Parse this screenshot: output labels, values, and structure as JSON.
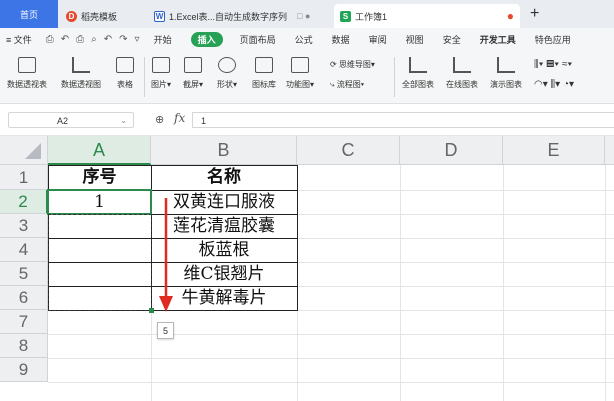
{
  "tabs": {
    "home": "首页",
    "template": "稻壳模板",
    "doc": "1.Excel表...自动生成数字序列",
    "doc_status": "□ ●",
    "workbook": "工作簿1",
    "workbook_dot": "●",
    "new_tab": "+"
  },
  "menu": {
    "file": "≡ 文件",
    "quick_access": [
      "⎙",
      "↶",
      "⎙",
      "⌕",
      "↶",
      "↷",
      "▿"
    ],
    "items": [
      "开始",
      "插入",
      "页面布局",
      "公式",
      "数据",
      "审阅",
      "视图",
      "安全",
      "开发工具",
      "特色应用"
    ],
    "active": "插入"
  },
  "toolbar": {
    "pivot_table": "数据透视表",
    "pivot_chart": "数据透视图",
    "table": "表格",
    "picture": "图片▾",
    "screenshot": "截屏▾",
    "shape": "形状▾",
    "icon_lib": "图标库",
    "function_chart": "功能图▾",
    "mindmap": "思维导图▾",
    "flowchart": "流程图▾",
    "all_charts": "全部图表",
    "online_chart": "在线图表",
    "demo_chart": "演示图表"
  },
  "formula_bar": {
    "cell_ref": "A2",
    "dropdown": "⌄",
    "zoom_icon": "⊕",
    "fx": "fx",
    "value": "1"
  },
  "sheet": {
    "columns": [
      "A",
      "B",
      "C",
      "D",
      "E"
    ],
    "rows": [
      "1",
      "2",
      "3",
      "4",
      "5",
      "6",
      "7",
      "8",
      "9"
    ],
    "header": {
      "a": "序号",
      "b": "名称"
    },
    "a2": "1",
    "names": [
      "双黄连口服液",
      "莲花清瘟胶囊",
      "板蓝根",
      "维C银翘片",
      "牛黄解毒片"
    ],
    "autofill_tag": "5",
    "arrow_color": "#e02b20",
    "selection_color": "#2c8a4d"
  }
}
